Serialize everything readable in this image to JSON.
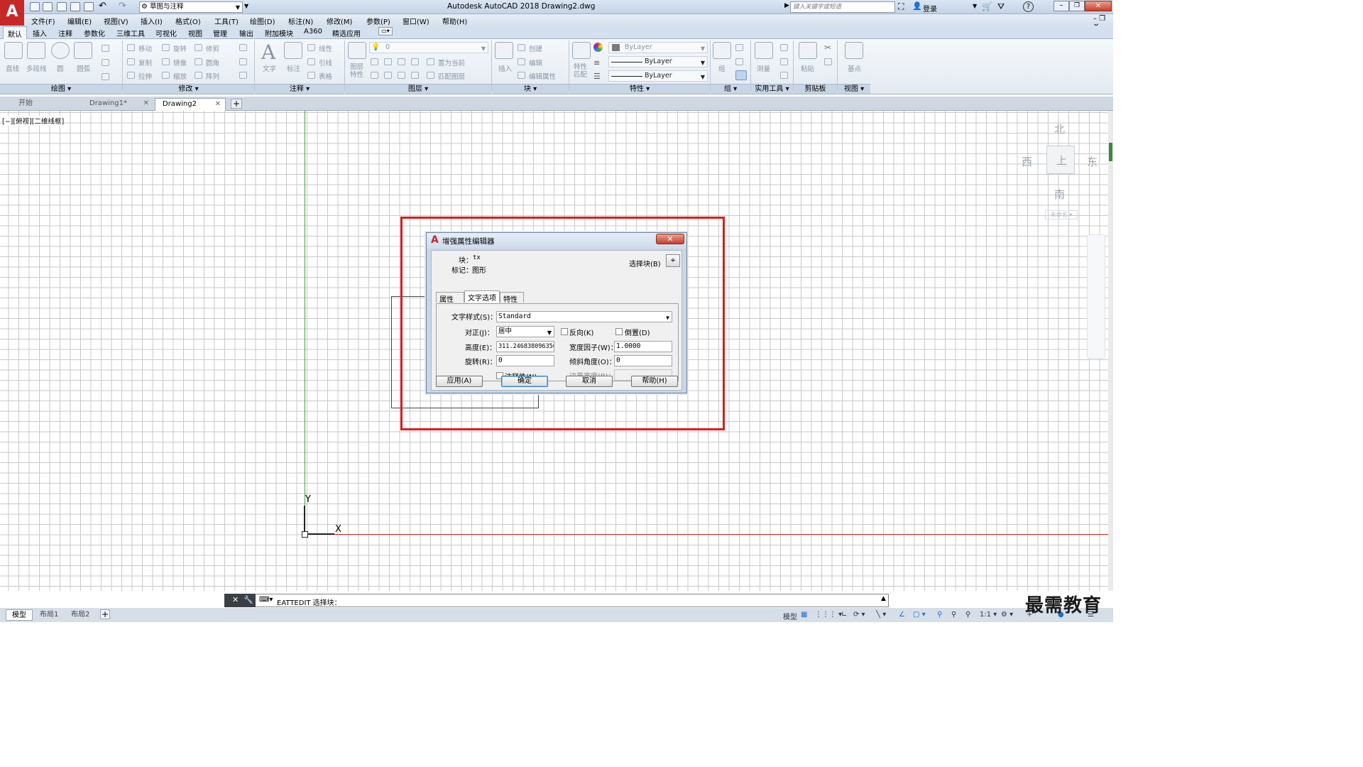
{
  "app": {
    "logo_letter": "A",
    "title": "Autodesk AutoCAD 2018    Drawing2.dwg",
    "workspace": "草图与注释",
    "search_placeholder": "键入关键字或短语",
    "login": "登录"
  },
  "menu": [
    "文件(F)",
    "编辑(E)",
    "视图(V)",
    "插入(I)",
    "格式(O)",
    "工具(T)",
    "绘图(D)",
    "标注(N)",
    "修改(M)",
    "参数(P)",
    "窗口(W)",
    "帮助(H)"
  ],
  "ribbon_tabs": [
    "默认",
    "插入",
    "注释",
    "参数化",
    "三维工具",
    "可视化",
    "视图",
    "管理",
    "输出",
    "附加模块",
    "A360",
    "精选应用"
  ],
  "ribbon": {
    "draw": {
      "title": "绘图",
      "tools": [
        "直线",
        "多段线",
        "圆",
        "圆弧"
      ]
    },
    "modify": {
      "title": "修改",
      "tools": [
        "移动",
        "旋转",
        "修剪",
        "复制",
        "镜像",
        "圆角",
        "拉伸",
        "缩放",
        "阵列"
      ]
    },
    "annotation": {
      "title": "注释",
      "tools": [
        "文字",
        "标注",
        "线性",
        "引线",
        "表格"
      ]
    },
    "layers": {
      "title": "图层",
      "tools": [
        "图层特性",
        "置为当前",
        "匹配图层"
      ],
      "current": "0"
    },
    "block": {
      "title": "块",
      "tools": [
        "插入",
        "创建",
        "编辑",
        "编辑属性"
      ]
    },
    "properties": {
      "title": "特性",
      "tools": [
        "特性匹配"
      ],
      "color": "ByLayer",
      "linetype": "ByLayer",
      "lineweight": "ByLayer"
    },
    "group": {
      "title": "组",
      "tools": [
        "组"
      ]
    },
    "utilities": {
      "title": "实用工具",
      "tools": [
        "测量"
      ]
    },
    "clipboard": {
      "title": "剪贴板",
      "tools": [
        "粘贴"
      ]
    },
    "view": {
      "title": "视图",
      "tools": [
        "基点"
      ]
    }
  },
  "doc_tabs": [
    {
      "label": "开始",
      "closable": false,
      "active": false
    },
    {
      "label": "Drawing1*",
      "closable": true,
      "active": false
    },
    {
      "label": "Drawing2",
      "closable": true,
      "active": true
    }
  ],
  "viewport_label": "[−][俯视][二维线框]",
  "viewcube": {
    "north": "北",
    "south": "南",
    "east": "东",
    "west": "西",
    "top": "上",
    "wcs": "未命名"
  },
  "ucs": {
    "x": "X",
    "y": "Y"
  },
  "dialog": {
    "title": "增强属性编辑器",
    "block_label": "块：",
    "block_value": "tx",
    "tag_label": "标记：",
    "tag_value": "图形",
    "select_block_label": "选择块(B)",
    "tabs": [
      "属性",
      "文字选项",
      "特性"
    ],
    "active_tab": 1,
    "fields": {
      "text_style_label": "文字样式(S)：",
      "text_style_value": "Standard",
      "justify_label": "对正(J)：",
      "justify_value": "居中",
      "backwards_label": "反向(K)",
      "upside_down_label": "倒置(D)",
      "height_label": "高度(E)：",
      "height_value": "311.246838096350",
      "width_factor_label": "宽度因子(W)：",
      "width_factor_value": "1.0000",
      "rotation_label": "旋转(R)：",
      "rotation_value": "0",
      "oblique_label": "倾斜角度(O)：",
      "oblique_value": "0",
      "annotative_label": "注释性(N)",
      "boundary_label": "边界宽度(B)：",
      "boundary_value": ""
    },
    "buttons": {
      "apply": "应用(A)",
      "ok": "确定",
      "cancel": "取消",
      "help": "帮助(H)"
    }
  },
  "command_line": "EATTEDIT 选择块：",
  "layout_tabs": [
    "模型",
    "布局1",
    "布局2"
  ],
  "status": {
    "model": "模型",
    "scale": "1:1"
  },
  "watermark": "最需教育",
  "colors": {
    "highlight_box": "#e01b1b",
    "axis_y": "#3aa63a",
    "axis_x": "#d22b2b"
  }
}
